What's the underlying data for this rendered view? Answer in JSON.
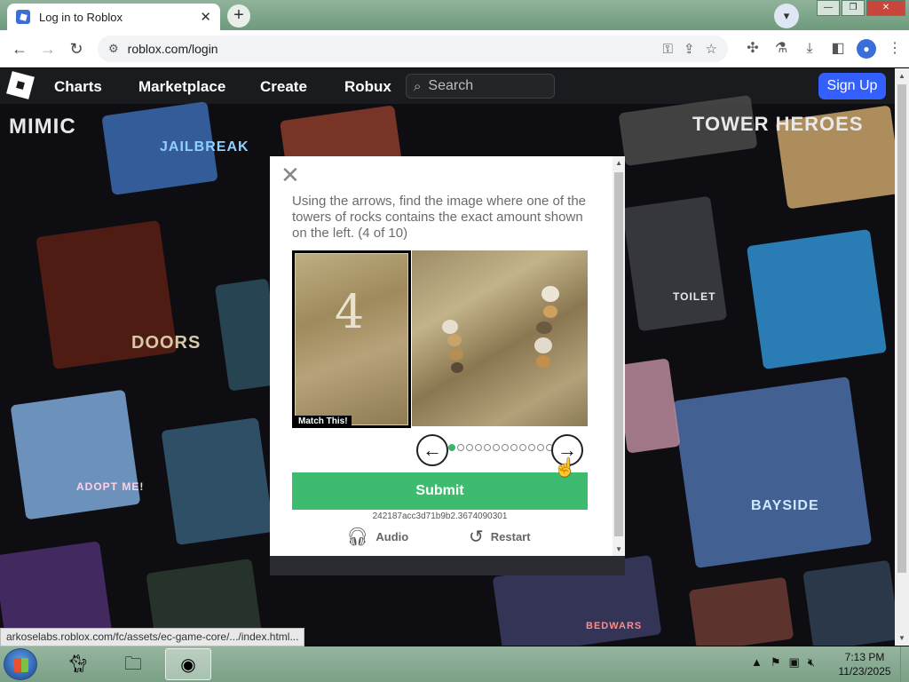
{
  "browser": {
    "tab_title": "Log in to Roblox",
    "url": "roblox.com/login",
    "status_url": "arkoselabs.roblox.com/fc/assets/ec-game-core/.../index.html..."
  },
  "roblox_nav": {
    "links": [
      "Charts",
      "Marketplace",
      "Create",
      "Robux"
    ],
    "search_placeholder": "Search",
    "signup_label": "Sign Up"
  },
  "background_games": [
    "MIMIC",
    "JAILBREAK",
    "TOWER HEROES",
    "DOORS",
    "TOILET",
    "ADOPT ME!",
    "BAYSIDE",
    "BEDWARS"
  ],
  "captcha": {
    "prompt": "Using the arrows, find the image where one of the towers of rocks contains the exact amount shown on the left. (4 of 10)",
    "target_number": "4",
    "match_label": "Match This!",
    "total_steps": 12,
    "current_step": 1,
    "submit_label": "Submit",
    "session_id": "242187acc3d71b9b2.3674090301",
    "audio_label": "Audio",
    "restart_label": "Restart"
  },
  "taskbar": {
    "time": "7:13 PM",
    "date": "11/23/2025"
  },
  "colors": {
    "signup": "#335fff",
    "submit": "#3dbb6e",
    "nav_bg": "#191b1f"
  }
}
